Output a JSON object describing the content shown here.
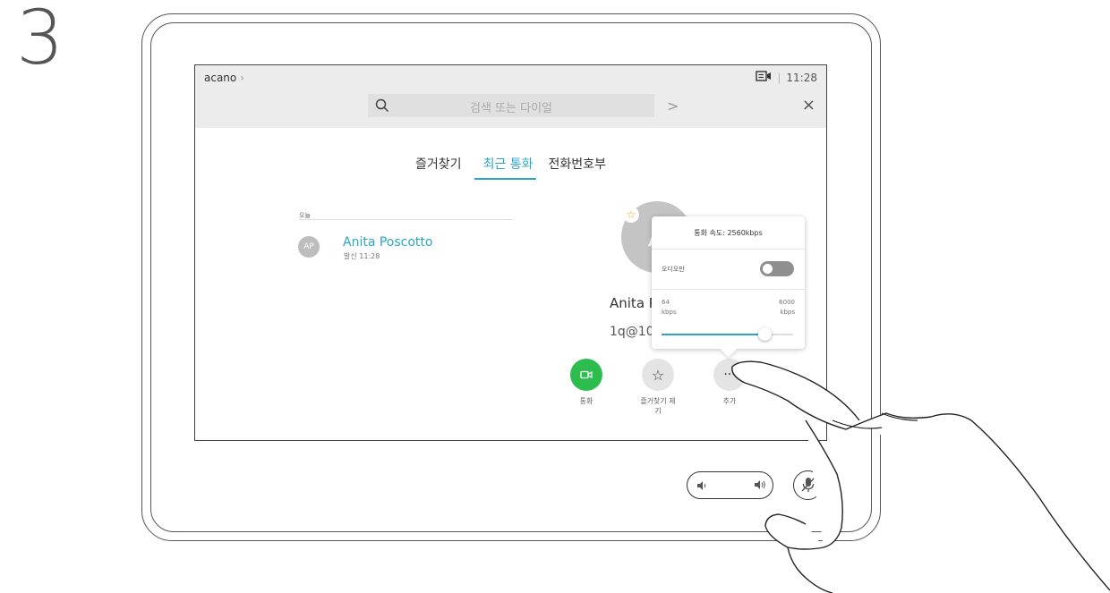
{
  "step": "3",
  "header": {
    "brand": "acano",
    "brand_chevron": "›",
    "time": "11:28",
    "separator": "|"
  },
  "search": {
    "placeholder": "검색 또는 다이얼",
    "next_glyph": ">",
    "close_glyph": "×"
  },
  "tabs": [
    {
      "label": "즐거찾기",
      "active": false
    },
    {
      "label": "최근 통화",
      "active": true
    },
    {
      "label": "전화번호부",
      "active": false
    }
  ],
  "recents": {
    "section_label": "오늘",
    "items": [
      {
        "initials": "AP",
        "name": "Anita Poscotto",
        "detail": "발신 11:28"
      }
    ]
  },
  "detail": {
    "avatar_initial": "A",
    "name": "Anita P",
    "address": "1q@10",
    "actions": [
      {
        "label": "통화",
        "icon": "video-camera-icon",
        "color": "#2dbd4e"
      },
      {
        "label": "즐거찾기 제\n기",
        "icon": "star-icon",
        "color": "#e4e4e4"
      },
      {
        "label": "추가",
        "icon": "more-icon",
        "color": "#e4e4e4"
      }
    ]
  },
  "popover": {
    "title": "통화 속도: 2560kbps",
    "audio_only_label": "오디오만",
    "audio_only_enabled": false,
    "min_value": "64",
    "max_value": "6000",
    "unit": "kbps",
    "slider_fraction": 0.78
  },
  "colors": {
    "accent": "#2aa6c8",
    "call_green": "#2dbd4e",
    "favorite_star": "#e8a418"
  }
}
